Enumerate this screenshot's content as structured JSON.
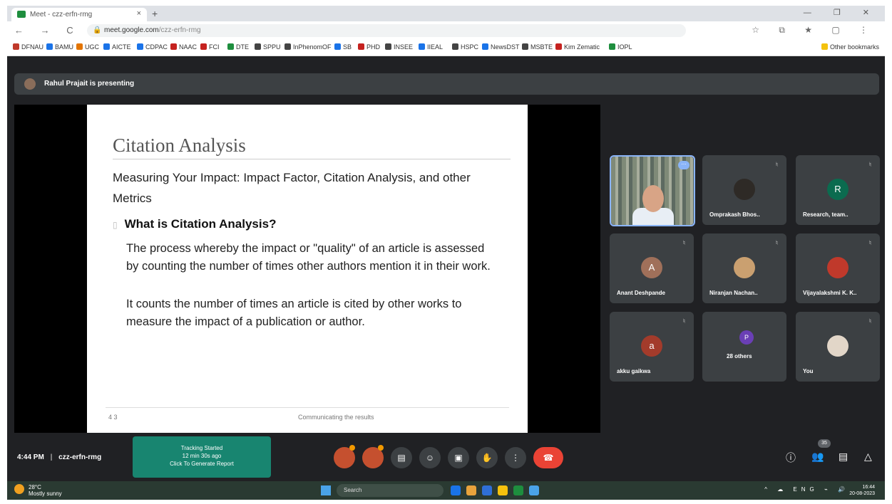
{
  "browser": {
    "tab_title": "Meet - czz-erfn-rmg",
    "tab_close": "×",
    "new_tab": "+",
    "window_controls": "— ❐ ✕",
    "nav_buttons": "← → C ⌂",
    "url_host": "meet.google.com",
    "url_path": "/czz-erfn-rmg",
    "right_icons": "☆ ⧉ ★ ▢ ⋮",
    "bookmarks": [
      {
        "label": "DFNAU",
        "color": "#c0392b"
      },
      {
        "label": "BAMU",
        "color": "#1a73e8"
      },
      {
        "label": "UGC",
        "color": "#e37400"
      },
      {
        "label": "AICTE",
        "color": "#1a73e8"
      },
      {
        "label": "CDPAC",
        "color": "#1a73e8"
      },
      {
        "label": "NAAC",
        "color": "#c5221f"
      },
      {
        "label": "FCI",
        "color": "#c5221f"
      },
      {
        "label": "DTE",
        "color": "#1e8e3e"
      },
      {
        "label": "SPPU",
        "color": "#444444"
      },
      {
        "label": "InPhenomOF",
        "color": "#444444"
      },
      {
        "label": "SB",
        "color": "#1a73e8"
      },
      {
        "label": "PHD",
        "color": "#c5221f"
      },
      {
        "label": "INSEE",
        "color": "#444444"
      },
      {
        "label": "IIEAL",
        "color": "#1a73e8"
      },
      {
        "label": "HSPC",
        "color": "#444444"
      },
      {
        "label": "NewsDST",
        "color": "#1a73e8"
      },
      {
        "label": "MSBTE",
        "color": "#444444"
      },
      {
        "label": "Kim Zematic",
        "color": "#c5221f"
      },
      {
        "label": "IOPL",
        "color": "#1e8e3e"
      },
      {
        "label": "Other bookmarks",
        "color": "#f4c20d"
      }
    ]
  },
  "meet": {
    "presenter_banner": "Rahul Prajait is presenting",
    "slide": {
      "title": "Citation Analysis",
      "subtitle": "Measuring Your Impact: Impact Factor, Citation Analysis, and other Metrics",
      "bullet_marker": "▯",
      "question": "What is Citation Analysis?",
      "para1": "The process whereby the impact or \"quality\" of an article is assessed by counting the number of times other authors mention it in their work.",
      "para2": "It counts the number of times an article is cited by other works to measure the impact of a publication or author.",
      "slide_number": "4 3",
      "footer": "Communicating the results"
    },
    "participants": [
      {
        "name": "",
        "initial": "",
        "type": "video",
        "badge": "⋯"
      },
      {
        "name": "Omprakash Bhos..",
        "initial": "",
        "type": "photo",
        "avatar_color": "#2e2a26"
      },
      {
        "name": "Research, team..",
        "initial": "R",
        "type": "letter",
        "avatar_color": "#0b6b4f"
      },
      {
        "name": "Anant Deshpande",
        "initial": "A",
        "type": "letter",
        "avatar_color": "#a0705a"
      },
      {
        "name": "Niranjan Nachan..",
        "initial": "",
        "type": "photo",
        "avatar_color": "#caa070"
      },
      {
        "name": "Vijayalakshmi K. K..",
        "initial": "",
        "type": "photo",
        "avatar_color": "#c0392b"
      },
      {
        "name": "akku gaikwa",
        "initial": "a",
        "type": "letter",
        "avatar_color": "#a33b2b"
      },
      {
        "name": "28 others",
        "initial": "P",
        "type": "others",
        "avatar_color": "#6a3fb5"
      },
      {
        "name": "You",
        "initial": "",
        "type": "photo",
        "avatar_color": "#e2d6c8"
      }
    ],
    "mic_icon": "♮",
    "bottom": {
      "time": "4:44 PM",
      "separator": "|",
      "meeting_code": "czz-erfn-rmg",
      "toast_line1": "Tracking Started",
      "toast_line2": "12 min 30s ago",
      "toast_line3": "Click To Generate Report",
      "controls": [
        "",
        "",
        "▤",
        "☺",
        "▣",
        "✋",
        "⋮",
        "☎"
      ],
      "right_icons": [
        "ⓘ",
        "👥",
        "▤",
        "△"
      ],
      "people_count": "35"
    }
  },
  "taskbar": {
    "weather_temp": "28°C",
    "weather_desc": "Mostly sunny",
    "search_label": "Search",
    "tray": "^ ☁ ENG ⌁ 🔊",
    "clock_time": "16:44",
    "clock_date": "20-08-2023",
    "app_colors": [
      "#1a73e8",
      "#e8a33c",
      "#2f6fd6",
      "#f4c20d",
      "#1e8e3e",
      "#4aa3e8"
    ]
  }
}
